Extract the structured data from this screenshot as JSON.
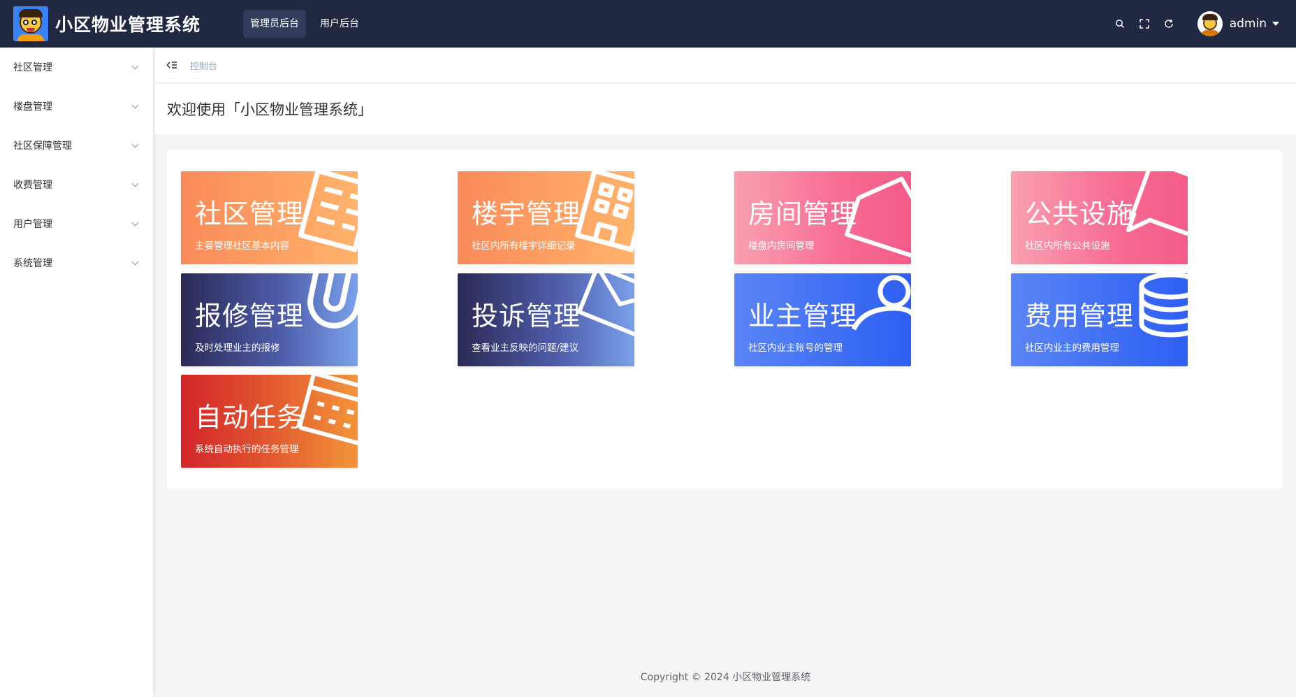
{
  "header": {
    "app_title": "小区物业管理系统",
    "tabs": [
      {
        "label": "管理员后台",
        "active": true
      },
      {
        "label": "用户后台",
        "active": false
      }
    ],
    "icons": [
      "search-icon",
      "fullscreen-icon",
      "refresh-icon"
    ],
    "user_name": "admin",
    "bg_color": "#212841"
  },
  "sidebar": {
    "items": [
      {
        "label": "社区管理"
      },
      {
        "label": "楼盘管理"
      },
      {
        "label": "社区保障管理"
      },
      {
        "label": "收费管理"
      },
      {
        "label": "用户管理"
      },
      {
        "label": "系统管理"
      }
    ]
  },
  "breadcrumb": {
    "current": "控制台"
  },
  "welcome": {
    "text": "欢迎使用「小区物业管理系统」"
  },
  "cards": [
    {
      "title": "社区管理",
      "subtitle": "主要管理社区基本内容",
      "theme": "orange",
      "icon": "building-icon"
    },
    {
      "title": "楼宇管理",
      "subtitle": "社区内所有楼宇详细记录",
      "theme": "orange",
      "icon": "building-icon"
    },
    {
      "title": "房间管理",
      "subtitle": "楼盘内房间管理",
      "theme": "pink",
      "icon": "house-icon"
    },
    {
      "title": "公共设施",
      "subtitle": "社区内所有公共设施",
      "theme": "pink",
      "icon": "chat-icon"
    },
    {
      "title": "报修管理",
      "subtitle": "及时处理业主的报修",
      "theme": "purple",
      "icon": "magnet-icon"
    },
    {
      "title": "投诉管理",
      "subtitle": "查看业主反映的问题/建议",
      "theme": "purple",
      "icon": "mail-icon"
    },
    {
      "title": "业主管理",
      "subtitle": "社区内业主账号的管理",
      "theme": "blue",
      "icon": "user-icon"
    },
    {
      "title": "费用管理",
      "subtitle": "社区内业主的费用管理",
      "theme": "blue",
      "icon": "coins-icon"
    },
    {
      "title": "自动任务",
      "subtitle": "系统自动执行的任务管理",
      "theme": "red",
      "icon": "keyboard-icon"
    }
  ],
  "footer": {
    "text": "Copyright © 2024 小区物业管理系统"
  }
}
